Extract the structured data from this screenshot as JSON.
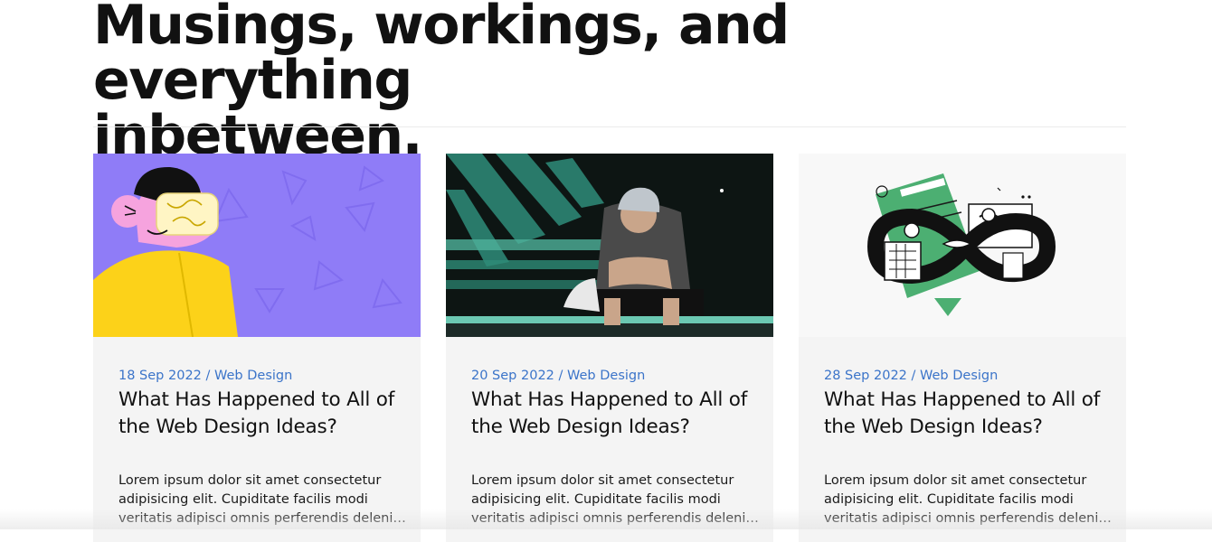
{
  "heading": {
    "line1": "Musings, workings, and everything",
    "line2": "inbetween."
  },
  "posts": [
    {
      "date": "18 Sep 2022",
      "separator": " / ",
      "category": "Web Design",
      "title": "What Has Happened to All of the Web Design Ideas?",
      "excerpt": "Lorem ipsum dolor sit amet consectetur adipisicing elit. Cupiditate facilis modi veritatis adipisci omnis perferendis deleniti inventore",
      "image": "illustration-vr-headset"
    },
    {
      "date": "20 Sep 2022",
      "separator": " / ",
      "category": "Web Design",
      "title": "What Has Happened to All of the Web Design Ideas?",
      "excerpt": "Lorem ipsum dolor sit amet consectetur adipisicing elit. Cupiditate facilis modi veritatis adipisci omnis perferendis deleniti inventore",
      "image": "photo-man-with-phone"
    },
    {
      "date": "28 Sep 2022",
      "separator": " / ",
      "category": "Web Design",
      "title": "What Has Happened to All of the Web Design Ideas?",
      "excerpt": "Lorem ipsum dolor sit amet consectetur adipisicing elit. Cupiditate facilis modi veritatis adipisci omnis perferendis deleniti inventore",
      "image": "illustration-infinity-collaboration"
    }
  ],
  "colors": {
    "accent": "#3b74c9",
    "card_bg": "#f4f4f4",
    "heading": "#111111"
  }
}
